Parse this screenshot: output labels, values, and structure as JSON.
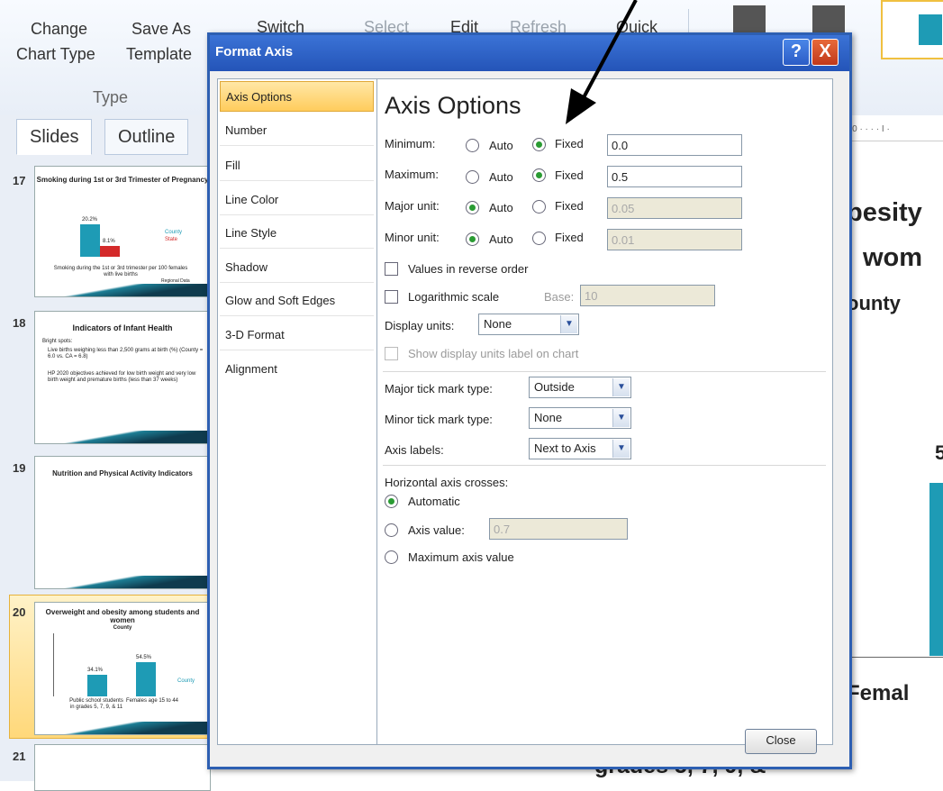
{
  "ribbon": {
    "change_chart_type_line1": "Change",
    "change_chart_type_line2": "Chart Type",
    "save_as_template_line1": "Save As",
    "save_as_template_line2": "Template",
    "switch_label": "Switch",
    "select_label": "Select",
    "edit_label": "Edit",
    "refresh_label": "Refresh",
    "quick_label": "Quick",
    "group_type": "Type",
    "accent_color": "#1e9bb5"
  },
  "left_pane": {
    "tabs": [
      "Slides",
      "Outline"
    ],
    "slides": [
      {
        "num": "17",
        "title": "Smoking during 1st or 3rd Trimester of Pregnancy",
        "v1": "20.2%",
        "v2": "8.1%",
        "legend1": "County",
        "legend2": "State",
        "caption": "Smoking during the 1st or 3rd trimester per 100 females with live births",
        "footer": "Regional Data"
      },
      {
        "num": "18",
        "title": "Indicators of Infant Health",
        "line1": "Bright spots:",
        "bullet1": "Live births weighing less than 2,500 grams at birth (%) (County = 6.0 vs. CA = 6.8)",
        "bullet2": "HP 2020 objectives achieved for low birth weight and very low birth weight and premature births (less than 37 weeks)"
      },
      {
        "num": "19",
        "title": "Nutrition and Physical Activity Indicators"
      },
      {
        "num": "20",
        "title": "Overweight and obesity among students and women",
        "subtitle": "County",
        "v1": "34.1%",
        "v2": "54.5%",
        "legend": "County",
        "cat1": "Public school students in grades 5, 7, 9, & 11",
        "cat2": "Females age 15 to 44"
      },
      {
        "num": "21"
      }
    ]
  },
  "slide_peek": {
    "t1": "besity",
    "t2": "wom",
    "t3": "ounty",
    "t4": "5",
    "t5": "Femal",
    "t6": "grades 5, 7, 9, &",
    "ruler": "· 0 · · · · I ·"
  },
  "dialog": {
    "title": "Format Axis",
    "help_glyph": "?",
    "close_glyph": "X",
    "nav": [
      "Axis Options",
      "Number",
      "Fill",
      "Line Color",
      "Line Style",
      "Shadow",
      "Glow and Soft Edges",
      "3-D Format",
      "Alignment"
    ],
    "heading": "Axis Options",
    "rows": {
      "minimum": {
        "label": "Minimum:",
        "auto": "Auto",
        "fixed": "Fixed",
        "value": "0.0"
      },
      "maximum": {
        "label": "Maximum:",
        "auto": "Auto",
        "fixed": "Fixed",
        "value": "0.5"
      },
      "major_unit": {
        "label": "Major unit:",
        "auto": "Auto",
        "fixed": "Fixed",
        "value": "0.05"
      },
      "minor_unit": {
        "label": "Minor unit:",
        "auto": "Auto",
        "fixed": "Fixed",
        "value": "0.01"
      }
    },
    "values_reverse_order": "Values in reverse order",
    "logarithmic_scale": "Logarithmic scale",
    "base_label": "Base:",
    "base_value": "10",
    "display_units_label": "Display units:",
    "display_units_value": "None",
    "show_units_label": "Show display units label on chart",
    "major_tick_label": "Major tick mark type:",
    "major_tick_value": "Outside",
    "minor_tick_label": "Minor tick mark type:",
    "minor_tick_value": "None",
    "axis_labels_label": "Axis labels:",
    "axis_labels_value": "Next to Axis",
    "horizontal_crosses_label": "Horizontal axis crosses:",
    "automatic": "Automatic",
    "axis_value_label": "Axis value:",
    "axis_value": "0.7",
    "maximum_axis_value": "Maximum axis value",
    "close_button": "Close"
  }
}
